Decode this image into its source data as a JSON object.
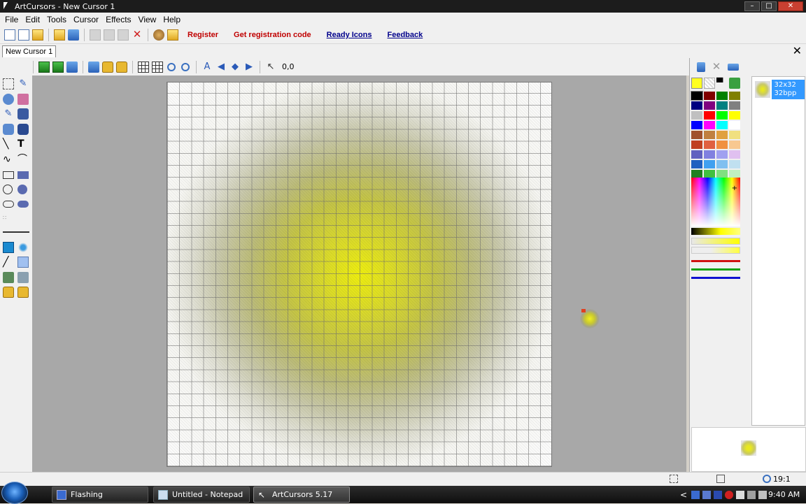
{
  "window": {
    "title": "ArtCursors - New Cursor 1",
    "minimize": "–",
    "maximize": "□",
    "close": "✕"
  },
  "menu": [
    "File",
    "Edit",
    "Tools",
    "Cursor",
    "Effects",
    "View",
    "Help"
  ],
  "toolbar": {
    "register": "Register",
    "get_code": "Get registration code",
    "ready_icons": "Ready Icons",
    "feedback": "Feedback"
  },
  "doc_tab": {
    "label": "New Cursor 1",
    "close": "✕"
  },
  "edit_toolbar": {
    "coordinates": "0,0"
  },
  "sizes": [
    {
      "label": "32x32 32bpp"
    }
  ],
  "size_label_line1": "32x32",
  "size_label_line2": "32bpp",
  "palette_colors": [
    "#000000",
    "#800000",
    "#008000",
    "#808000",
    "#000080",
    "#800080",
    "#008080",
    "#808080",
    "#c0c0c0",
    "#ff0000",
    "#00ff00",
    "#ffff00",
    "#0000ff",
    "#ff00ff",
    "#00ffff",
    "#ffffff",
    "#a0522d",
    "#c08040",
    "#e0a040",
    "#f0e080",
    "#c04020",
    "#e06040",
    "#f09040",
    "#f8c890",
    "#6060c0",
    "#8080e0",
    "#a0a0f0",
    "#e0c0f0",
    "#2060c0",
    "#40a0f0",
    "#80c0f0",
    "#c0e0f0",
    "#208020",
    "#40c040",
    "#80e080",
    "#c0f0c0"
  ],
  "status": {
    "zoom": "19:1"
  },
  "taskbar": {
    "items": [
      {
        "label": "Flashing",
        "active": false
      },
      {
        "label": "Untitled - Notepad",
        "active": false
      },
      {
        "label": "ArtCursors 5.17",
        "active": true
      }
    ],
    "clock": "9:40 AM",
    "tray_chevron": "<"
  }
}
